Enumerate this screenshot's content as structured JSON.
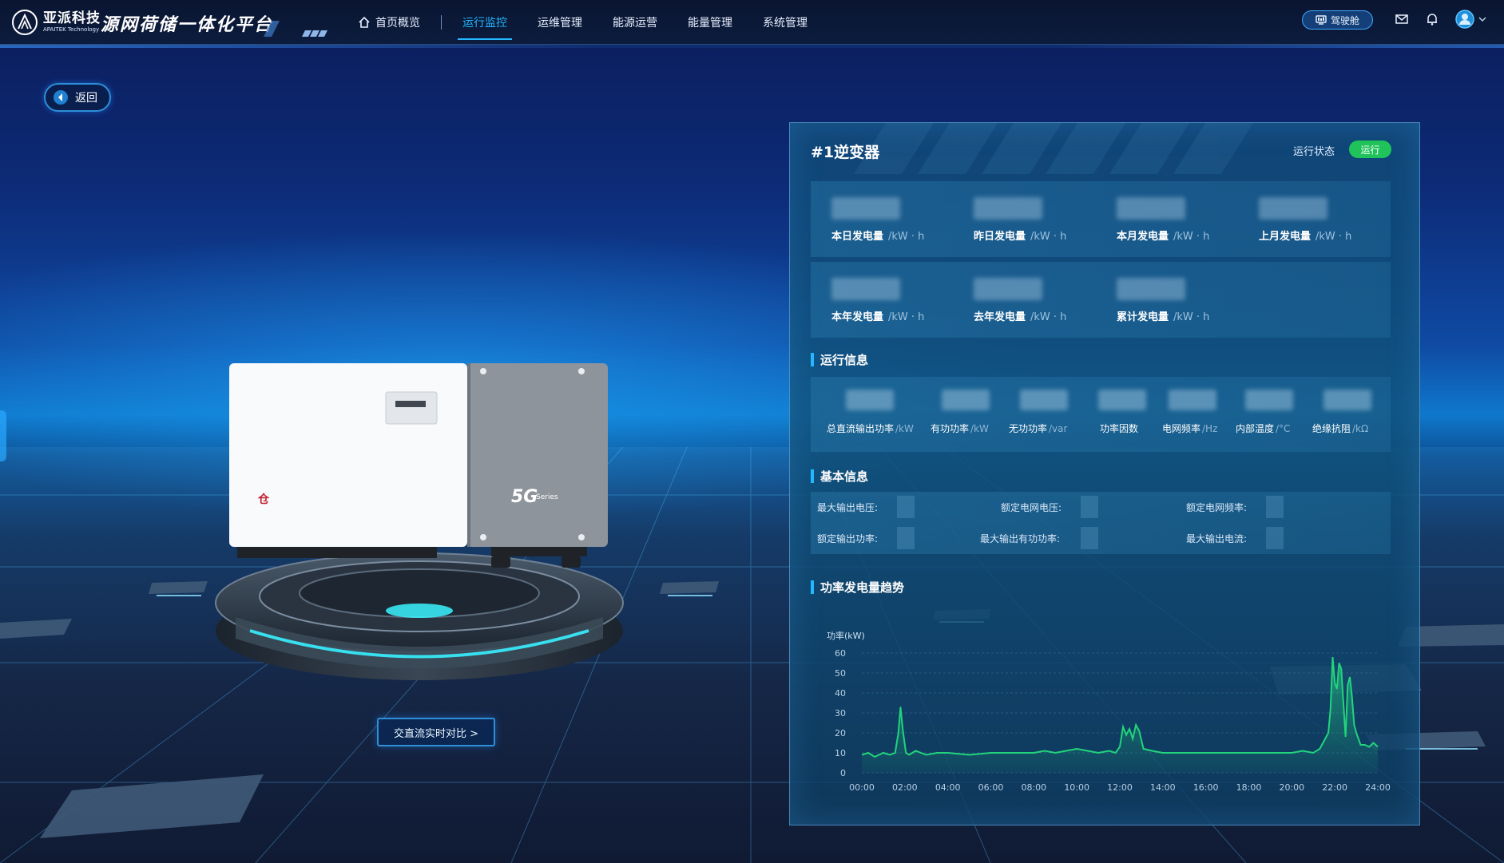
{
  "header": {
    "brand_cn": "亚派科技",
    "brand_en": "APAITEK Technology",
    "platform_title": "源网荷储一体化平台",
    "nav": [
      {
        "label": "首页概览",
        "active": false
      },
      {
        "label": "运行监控",
        "active": true
      },
      {
        "label": "运维管理",
        "active": false
      },
      {
        "label": "能源运营",
        "active": false
      },
      {
        "label": "能量管理",
        "active": false
      },
      {
        "label": "系统管理",
        "active": false
      }
    ],
    "cockpit_label": "驾驶舱",
    "icons": [
      "home-icon",
      "monitor-icon",
      "mail-icon",
      "bell-icon",
      "user-icon",
      "chevron-down-icon"
    ]
  },
  "back_label": "返回",
  "device": {
    "badge": "5G",
    "badge_sub": "Series"
  },
  "compare_button": "交直流实时对比 >",
  "panel": {
    "title": "#1逆变器",
    "status_label": "运行状态",
    "status_value": "运行",
    "status_color": "#1fc35a",
    "energy": [
      {
        "label": "本日发电量",
        "unit": "/kW · h"
      },
      {
        "label": "昨日发电量",
        "unit": "/kW · h"
      },
      {
        "label": "本月发电量",
        "unit": "/kW · h"
      },
      {
        "label": "上月发电量",
        "unit": "/kW · h"
      },
      {
        "label": "本年发电量",
        "unit": "/kW · h"
      },
      {
        "label": "去年发电量",
        "unit": "/kW · h"
      },
      {
        "label": "累计发电量",
        "unit": "/kW · h"
      }
    ],
    "run_section_title": "运行信息",
    "run_info": [
      {
        "label": "总直流输出功率",
        "unit": "/kW"
      },
      {
        "label": "有功功率",
        "unit": "/kW"
      },
      {
        "label": "无功功率",
        "unit": "/var"
      },
      {
        "label": "功率因数",
        "unit": ""
      },
      {
        "label": "电网频率",
        "unit": "/Hz"
      },
      {
        "label": "内部温度",
        "unit": "/°C"
      },
      {
        "label": "绝缘抗阻",
        "unit": "/kΩ"
      }
    ],
    "basic_section_title": "基本信息",
    "basic_info": [
      {
        "label": "最大输出电压:"
      },
      {
        "label": "额定电网电压:"
      },
      {
        "label": "额定电网频率:"
      },
      {
        "label": "额定输出功率:"
      },
      {
        "label": "最大输出有功功率:"
      },
      {
        "label": "最大输出电流:"
      }
    ],
    "trend_section_title": "功率发电量趋势"
  },
  "chart_data": {
    "type": "area",
    "ylabel": "功率(kW)",
    "ylim": [
      0,
      60
    ],
    "yticks": [
      0,
      10,
      20,
      30,
      40,
      50,
      60
    ],
    "xticks": [
      "00:00",
      "02:00",
      "04:00",
      "06:00",
      "08:00",
      "10:00",
      "12:00",
      "14:00",
      "16:00",
      "18:00",
      "20:00",
      "22:00",
      "24:00"
    ],
    "xlim": [
      0,
      24
    ],
    "line_color": "#22d47c",
    "grid": true,
    "series": [
      {
        "x": [
          0,
          0.3,
          0.6,
          1.0,
          1.3,
          1.55,
          1.7,
          1.8,
          1.9,
          2.05,
          2.2,
          2.5,
          3.0,
          3.5,
          4.0,
          5.0,
          6.0,
          7.0,
          8.0,
          8.5,
          9.0,
          9.5,
          10.0,
          10.5,
          11.0,
          11.5,
          11.8,
          12.0,
          12.15,
          12.3,
          12.45,
          12.6,
          12.75,
          12.9,
          13.1,
          13.5,
          14.0,
          15.0,
          16.0,
          17.0,
          18.0,
          19.0,
          20.0,
          20.5,
          21.0,
          21.3,
          21.5,
          21.7,
          21.8,
          21.9,
          22.0,
          22.1,
          22.2,
          22.3,
          22.4,
          22.5,
          22.6,
          22.7,
          22.8,
          22.9,
          23.0,
          23.2,
          23.4,
          23.6,
          23.8,
          24.0
        ],
        "y": [
          9,
          10,
          8,
          10,
          9,
          10,
          20,
          33,
          22,
          10,
          9,
          11,
          9,
          10,
          10,
          9,
          10,
          10,
          10,
          11,
          10,
          11,
          12,
          11,
          10,
          11,
          10,
          13,
          23,
          19,
          22,
          17,
          24,
          21,
          12,
          11,
          10,
          10,
          10,
          10,
          10,
          10,
          10,
          11,
          10,
          12,
          16,
          20,
          32,
          58,
          45,
          42,
          55,
          52,
          35,
          18,
          44,
          48,
          38,
          24,
          20,
          14,
          14,
          13,
          15,
          13
        ]
      }
    ]
  }
}
